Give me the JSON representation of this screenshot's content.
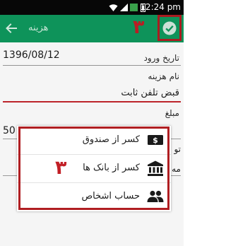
{
  "status_bar": {
    "time": "12:24 pm"
  },
  "action_bar": {
    "title": "هزینه",
    "step_number": "٣",
    "background_color": "#0f9a5e",
    "highlight_color": "#b01e22"
  },
  "form": {
    "date_label": "تاریخ ورود",
    "date_value": "1396/08/12",
    "cost_name_label": "نام هزینه",
    "cost_name_value": "قبض تلفن ثابت",
    "amount_label": "مبلغ",
    "amount_value_partial": "50",
    "partial_label_1": "تو",
    "partial_label_2": "مه"
  },
  "popup_menu": {
    "step_number": "٣",
    "items": [
      {
        "label": "کسر از صندوق",
        "icon": "cash-icon"
      },
      {
        "label": "کسر از بانک ها",
        "icon": "bank-icon"
      },
      {
        "label": "حساب اشخاص",
        "icon": "people-icon"
      }
    ]
  }
}
